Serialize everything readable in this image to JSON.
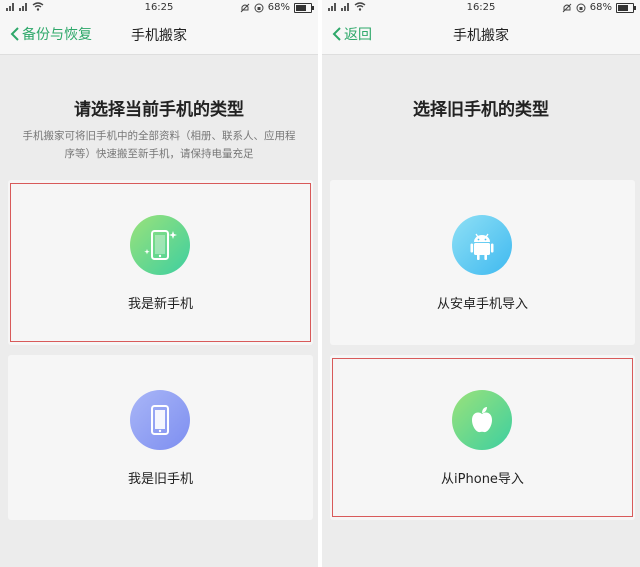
{
  "status_bar": {
    "time": "16:25",
    "battery": "68%",
    "battery_level": 0.68
  },
  "left": {
    "nav": {
      "back_label": "备份与恢复",
      "title": "手机搬家"
    },
    "heading": "请选择当前手机的类型",
    "description": "手机搬家可将旧手机中的全部资料（相册、联系人、应用程序等）快速搬至新手机，请保持电量充足",
    "options": [
      {
        "label": "我是新手机",
        "icon": "new-phone-icon",
        "selected": true,
        "color": "#5cd88f"
      },
      {
        "label": "我是旧手机",
        "icon": "old-phone-icon",
        "selected": false,
        "color": "#8a9cf2"
      }
    ]
  },
  "right": {
    "nav": {
      "back_label": "返回",
      "title": "手机搬家"
    },
    "heading": "选择旧手机的类型",
    "options": [
      {
        "label": "从安卓手机导入",
        "icon": "android-icon",
        "selected": false,
        "color": "#4fc3f2"
      },
      {
        "label": "从iPhone导入",
        "icon": "apple-icon",
        "selected": true,
        "color": "#5cd88f"
      }
    ]
  },
  "colors": {
    "accent": "#2ea86a",
    "selection_border": "#d85a5a"
  }
}
